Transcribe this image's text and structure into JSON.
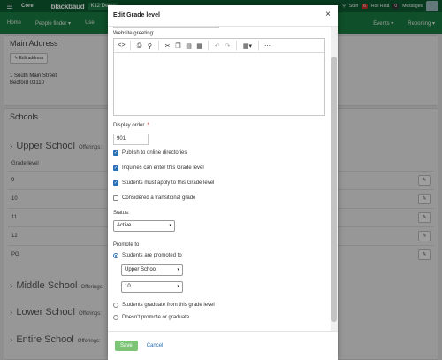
{
  "app": {
    "brand": "Core",
    "logo": "blackbaud",
    "product": "K12 Demo",
    "topbar_right": [
      "Staff",
      "6",
      "Roll Rata",
      "0",
      "Messages"
    ]
  },
  "nav": {
    "items": [
      "Home",
      "People finder ▾",
      "Use"
    ],
    "right_items": [
      "Events ▾",
      "Reporting ▾"
    ]
  },
  "main_address": {
    "heading": "Main Address",
    "edit_label": "Edit address",
    "lines": [
      "1 South Main Street",
      "Bedford 03110"
    ]
  },
  "schools": {
    "heading": "Schools",
    "upper": {
      "name": "Upper School",
      "offerings": "Offerings:"
    },
    "grade_col": "Grade level",
    "grades": [
      "9",
      "10",
      "11",
      "12",
      "PG"
    ],
    "others": [
      {
        "name": "Middle School",
        "offerings": "Offerings:"
      },
      {
        "name": "Lower School",
        "offerings": "Offerings:"
      },
      {
        "name": "Entire School",
        "offerings": "Offerings:"
      }
    ]
  },
  "modal": {
    "title": "Edit Grade level",
    "close": "×",
    "website_greeting_label": "Website greeting:",
    "toolbar_icons": [
      "code-icon",
      "print-icon",
      "search-icon",
      "cut-icon",
      "copy-icon",
      "paste-icon",
      "paste-text-icon",
      "undo-icon",
      "redo-icon",
      "table-icon",
      "more-icon"
    ],
    "display_order_label": "Display order",
    "required_mark": "*",
    "display_order_value": "901",
    "checkboxes": [
      {
        "label": "Publish to online directories",
        "checked": true
      },
      {
        "label": "Inquiries can enter this Grade level",
        "checked": true
      },
      {
        "label": "Students must apply to this Grade level",
        "checked": true
      },
      {
        "label": "Considered a transitional grade",
        "checked": false
      }
    ],
    "status_label": "Status:",
    "status_value": "Active",
    "promote_label": "Promote to",
    "promote_options": [
      {
        "label": "Students are promoted to",
        "selected": true
      },
      {
        "label": "Students graduate from this grade level",
        "selected": false
      },
      {
        "label": "Doesn't promote or graduate",
        "selected": false
      }
    ],
    "promote_school": "Upper School",
    "promote_grade": "10",
    "save_label": "Save",
    "cancel_label": "Cancel"
  },
  "colors": {
    "topbar": "#0b5a2f",
    "navbar": "#187a3f",
    "save_button": "#7cc576",
    "link": "#2a6fb5",
    "required": "#c9302c"
  }
}
